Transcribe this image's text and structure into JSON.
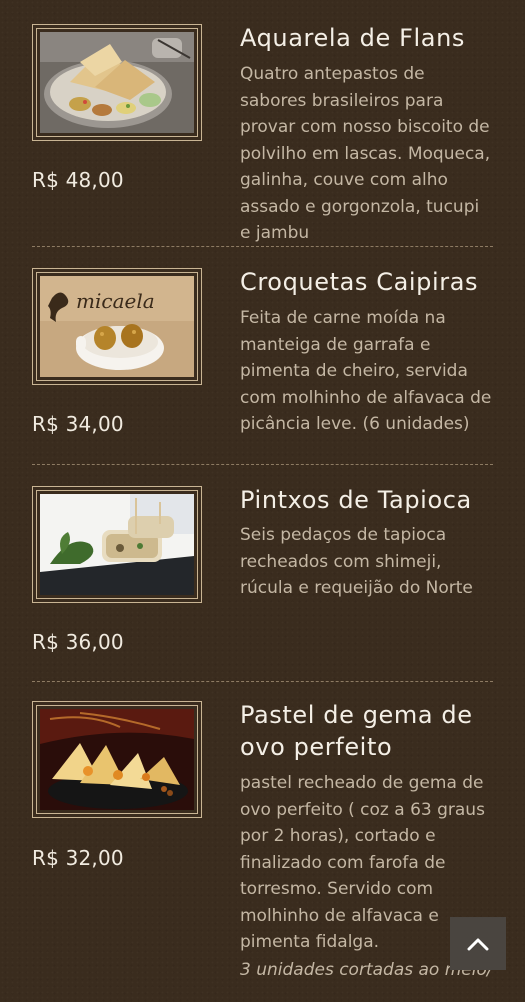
{
  "items": [
    {
      "name": "Aquarela de Flans",
      "description": "Quatro antepastos de sabores brasileiros para provar com nosso biscoito de polvilho em lascas. Moqueca, galinha, couve com alho assado e gorgonzola, tucupi e jambu",
      "price": "R$ 48,00"
    },
    {
      "name": "Croquetas Caipiras",
      "description": "Feita de carne moída na manteiga de garrafa e pimenta de cheiro, servida com molhinho de alfavaca de picância leve. (6 unidades)",
      "price": "R$ 34,00",
      "photo_text": "micaela"
    },
    {
      "name": "Pintxos de Tapioca",
      "description": "Seis pedaços de tapioca recheados com shimeji, rúcula e requeijão do Norte",
      "price": "R$ 36,00"
    },
    {
      "name": "Pastel de gema de ovo perfeito",
      "description": "pastel recheado de gema de ovo perfeito ( coz a 63 graus por 2 horas), cortado e finalizado com farofa de torresmo. Servido com molhinho de alfavaca e pimenta fidalga.",
      "note": "3 unidades cortadas ao meio/",
      "price": "R$ 32,00"
    }
  ],
  "back_to_top": {
    "icon": "chevron-up-icon"
  },
  "colors": {
    "background": "#3a2c1e",
    "title": "#f4efe6",
    "description": "#c4b7a4",
    "frame": "#c9b594",
    "divider": "#8d7b63"
  }
}
